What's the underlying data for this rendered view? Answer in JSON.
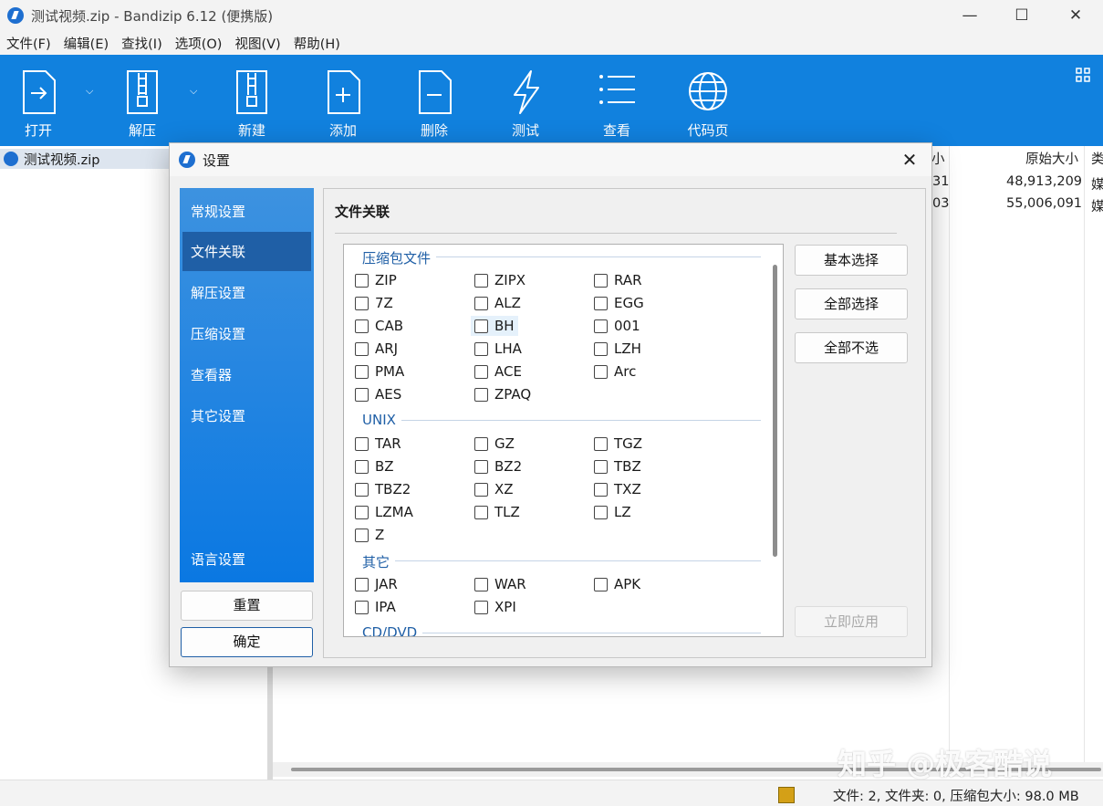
{
  "window": {
    "title": "测试视频.zip - Bandizip 6.12 (便携版)"
  },
  "menu": [
    "文件(F)",
    "编辑(E)",
    "查找(I)",
    "选项(O)",
    "视图(V)",
    "帮助(H)"
  ],
  "toolbar": {
    "open": "打开",
    "extract": "解压",
    "new": "新建",
    "add": "添加",
    "delete": "删除",
    "test": "测试",
    "view": "查看",
    "codepage": "代码页"
  },
  "tree": {
    "item": "测试视频.zip"
  },
  "columns": {
    "size": "小",
    "orig_size": "原始大小",
    "type": "类"
  },
  "rows": [
    {
      "size_frag": "31",
      "orig": "48,913,209",
      "type_frag": "媒"
    },
    {
      "size_frag": "03",
      "orig": "55,006,091",
      "type_frag": "媒"
    }
  ],
  "status": {
    "text": "文件: 2, 文件夹: 0, 压缩包大小: 98.0 MB"
  },
  "watermark": "知乎 @极客酷说",
  "dialog": {
    "title": "设置",
    "nav": [
      "常规设置",
      "文件关联",
      "解压设置",
      "压缩设置",
      "查看器",
      "其它设置",
      "语言设置"
    ],
    "nav_active": "文件关联",
    "reset": "重置",
    "ok": "确定",
    "section_title": "文件关联",
    "groups": {
      "archive": "压缩包文件",
      "unix": "UNIX",
      "other": "其它",
      "cddvd": "CD/DVD"
    },
    "archive_items": [
      "ZIP",
      "ZIPX",
      "RAR",
      "7Z",
      "ALZ",
      "EGG",
      "CAB",
      "BH",
      "001",
      "ARJ",
      "LHA",
      "LZH",
      "PMA",
      "ACE",
      "Arc",
      "AES",
      "ZPAQ"
    ],
    "unix_items": [
      "TAR",
      "GZ",
      "TGZ",
      "BZ",
      "BZ2",
      "TBZ",
      "TBZ2",
      "XZ",
      "TXZ",
      "LZMA",
      "TLZ",
      "LZ",
      "Z"
    ],
    "other_items": [
      "JAR",
      "WAR",
      "APK",
      "IPA",
      "XPI"
    ],
    "buttons": {
      "basic": "基本选择",
      "all": "全部选择",
      "none": "全部不选",
      "apply": "立即应用"
    }
  }
}
